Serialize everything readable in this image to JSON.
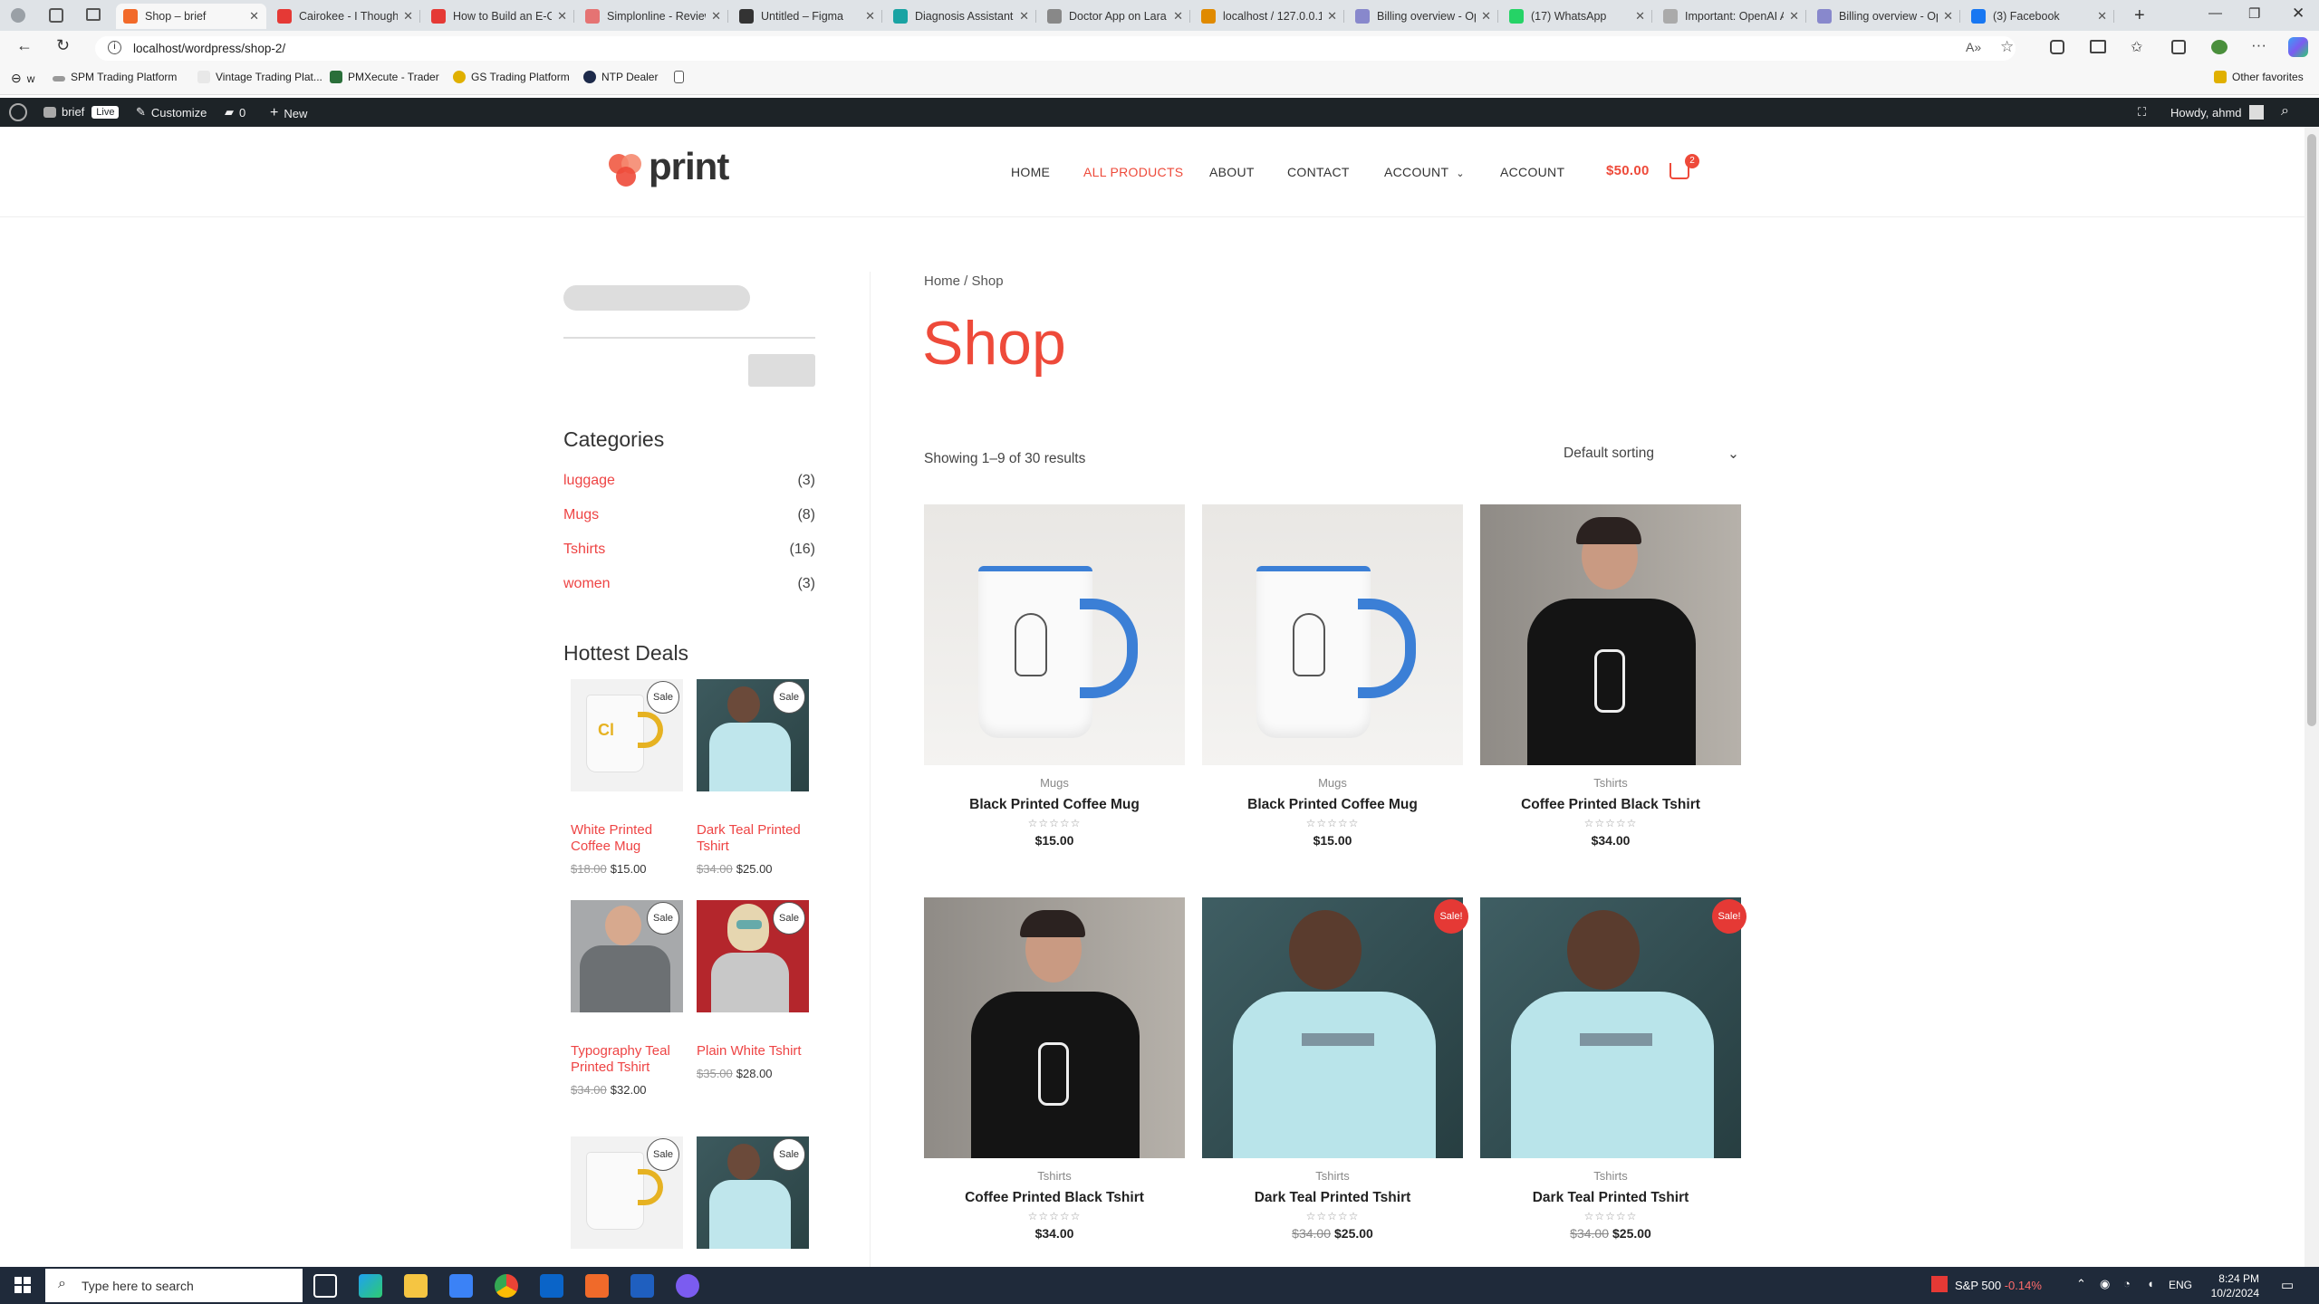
{
  "browser": {
    "tabs": [
      {
        "title": "Shop – brief",
        "color": "#f26a2a",
        "active": true
      },
      {
        "title": "Cairokee - I Thought",
        "color": "#e53935"
      },
      {
        "title": "How to Build an E-C",
        "color": "#e53935"
      },
      {
        "title": "Simplonline - Review",
        "color": "#e57373"
      },
      {
        "title": "Untitled – Figma",
        "color": "#333333"
      },
      {
        "title": "Diagnosis Assistant",
        "color": "#1aa3a3"
      },
      {
        "title": "Doctor App on Lara",
        "color": "#888888"
      },
      {
        "title": "localhost / 127.0.0.1",
        "color": "#e08a00"
      },
      {
        "title": "Billing overview - Op",
        "color": "#8888cc"
      },
      {
        "title": "(17) WhatsApp",
        "color": "#25d366"
      },
      {
        "title": "Important: OpenAI A",
        "color": "#aaaaaa"
      },
      {
        "title": "Billing overview - Op",
        "color": "#8888cc"
      },
      {
        "title": "(3) Facebook",
        "color": "#1877f2"
      }
    ],
    "url": "localhost/wordpress/shop-2/",
    "bookmarks": [
      "w",
      "SPM Trading Platform",
      "Vintage Trading Plat...",
      "PMXecute - Trader",
      "GS Trading Platform",
      "NTP Dealer"
    ],
    "other_favorites": "Other favorites"
  },
  "wpbar": {
    "site": "brief",
    "live": "Live",
    "customize": "Customize",
    "comments": "0",
    "new": "New",
    "howdy": "Howdy, ahmd"
  },
  "header": {
    "logo": "print",
    "nav": [
      "HOME",
      "ALL PRODUCTS",
      "ABOUT",
      "CONTACT",
      "ACCOUNT",
      "ACCOUNT"
    ],
    "cart_total": "$50.00",
    "cart_count": "2"
  },
  "sidebar": {
    "categories_title": "Categories",
    "categories": [
      {
        "name": "luggage",
        "count": "(3)"
      },
      {
        "name": "Mugs",
        "count": "(8)"
      },
      {
        "name": "Tshirts",
        "count": "(16)"
      },
      {
        "name": "women",
        "count": "(3)"
      }
    ],
    "deals_title": "Hottest Deals",
    "deals": [
      {
        "name": "White Printed Coffee Mug",
        "old": "$18.00",
        "price": "$15.00",
        "badge": "Sale"
      },
      {
        "name": "Dark Teal Printed Tshirt",
        "old": "$34.00",
        "price": "$25.00",
        "badge": "Sale"
      },
      {
        "name": "Typography Teal Printed Tshirt",
        "old": "$34.00",
        "price": "$32.00",
        "badge": "Sale"
      },
      {
        "name": "Plain White Tshirt",
        "old": "$35.00",
        "price": "$28.00",
        "badge": "Sale"
      },
      {
        "badge": "Sale"
      },
      {
        "badge": "Sale"
      }
    ]
  },
  "main": {
    "breadcrumb": {
      "home": "Home",
      "sep": " / ",
      "current": "Shop"
    },
    "title": "Shop",
    "result_count": "Showing 1–9 of 30 results",
    "sorting": "Default sorting",
    "products": [
      {
        "category": "Mugs",
        "name": "Black Printed Coffee Mug",
        "price": "$15.00"
      },
      {
        "category": "Mugs",
        "name": "Black Printed Coffee Mug",
        "price": "$15.00"
      },
      {
        "category": "Tshirts",
        "name": "Coffee Printed Black Tshirt",
        "price": "$34.00"
      },
      {
        "category": "Tshirts",
        "name": "Coffee Printed Black Tshirt",
        "price": "$34.00"
      },
      {
        "category": "Tshirts",
        "name": "Dark Teal Printed Tshirt",
        "old": "$34.00",
        "price": "$25.00",
        "sale": "Sale!"
      },
      {
        "category": "Tshirts",
        "name": "Dark Teal Printed Tshirt",
        "old": "$34.00",
        "price": "$25.00",
        "sale": "Sale!"
      }
    ]
  },
  "taskbar": {
    "search_placeholder": "Type here to search",
    "stock": "S&P 500",
    "stock_change": "-0.14%",
    "lang": "ENG",
    "time": "8:24 PM",
    "date": "10/2/2024"
  }
}
